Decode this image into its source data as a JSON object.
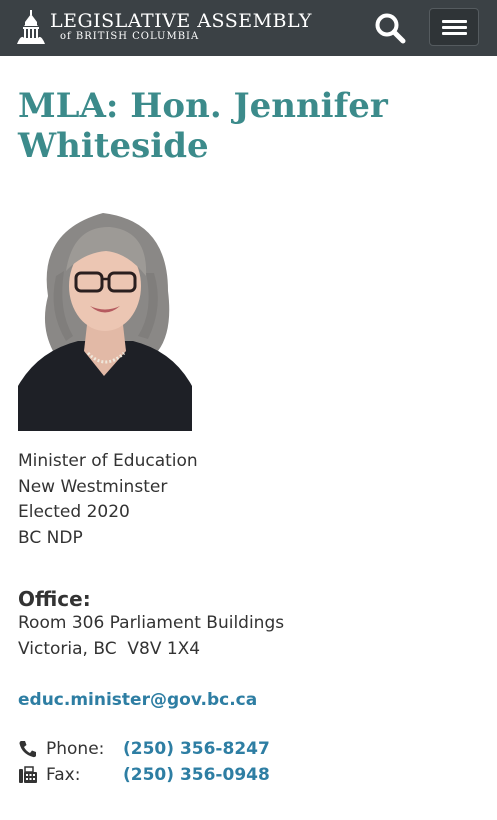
{
  "header": {
    "logo_title": "LEGISLATIVE ASSEMBLY",
    "logo_subtitle": "of BRITISH COLUMBIA",
    "icons": [
      "parliament-building-icon",
      "search-icon",
      "hamburger-menu-icon"
    ]
  },
  "page": {
    "title": "MLA: Hon. Jennifer Whiteside"
  },
  "profile": {
    "role": "Minister of Education",
    "riding": "New Westminster",
    "elected": "Elected 2020",
    "party": "BC NDP"
  },
  "office": {
    "label": "Office:",
    "address_line1": "Room 306 Parliament Buildings",
    "address_line2": "Victoria, BC  V8V 1X4"
  },
  "contact": {
    "email": "educ.minister@gov.bc.ca",
    "phone_label": "Phone:",
    "phone": "(250) 356-8247",
    "fax_label": "Fax:",
    "fax": "(250) 356-0948"
  },
  "colors": {
    "header_bg": "#3b4145",
    "title": "#3c8b8b",
    "link": "#2e7ea3"
  }
}
